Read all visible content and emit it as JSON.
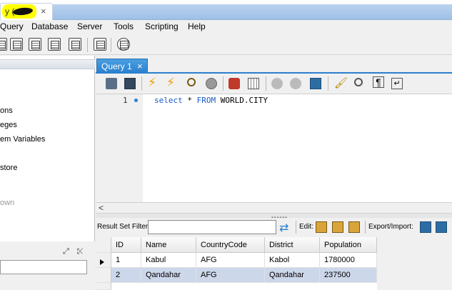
{
  "app_tab": {
    "title": "y (",
    "close": "×"
  },
  "menu": [
    "Query",
    "Database",
    "Server",
    "Tools",
    "Scripting",
    "Help"
  ],
  "sidebar": {
    "items": [
      {
        "label": "ons",
        "disabled": false
      },
      {
        "label": "eges",
        "disabled": false
      },
      {
        "label": "em Variables",
        "disabled": false
      },
      {
        "label": "store",
        "disabled": false
      },
      {
        "label": "own",
        "disabled": true
      }
    ],
    "footer_icons": "⤢ ⤪"
  },
  "query_tab": {
    "label": "Query 1",
    "close": "×"
  },
  "editor": {
    "line_number": "1",
    "tokens": {
      "kw1": "select",
      "star": " * ",
      "kw2": "FROM",
      "table": " WORLD.CITY"
    }
  },
  "result_toolbar": {
    "filter_label": "Result Set Filter:",
    "filter_value": "",
    "edit_label": "Edit:",
    "export_label": "Export/Import:"
  },
  "grid": {
    "columns": [
      "ID",
      "Name",
      "CountryCode",
      "District",
      "Population"
    ],
    "rows": [
      [
        "1",
        "Kabul",
        "AFG",
        "Kabol",
        "1780000"
      ],
      [
        "2",
        "Qandahar",
        "AFG",
        "Qandahar",
        "237500"
      ]
    ],
    "selected_row": 1
  },
  "colors": {
    "accent": "#2a80cf",
    "selection": "#cdd7ea",
    "highlight": "#ffff00"
  }
}
